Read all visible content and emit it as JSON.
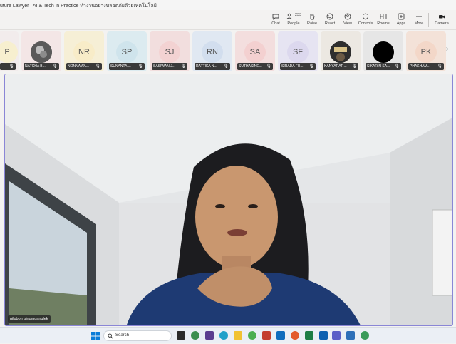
{
  "window": {
    "title": "uture Lawyer : AI & Tech in Practice ทำงานอย่างปลอดภัยด้วยเทคโนโลยี"
  },
  "toolbar": {
    "chat": "Chat",
    "people": "People",
    "people_count": "233",
    "raise": "Raise",
    "react": "React",
    "view": "View",
    "controls": "Controls",
    "rooms": "Rooms",
    "apps": "Apps",
    "more": "More",
    "camera": "Camera"
  },
  "participants": [
    {
      "initials": "P",
      "name": "",
      "color": "#f7efcf"
    },
    {
      "initials": "",
      "name": "NATCHA B...",
      "color": "#f3e6e6"
    },
    {
      "initials": "NR",
      "name": "NONNAWA...",
      "color": "#f6efd6"
    },
    {
      "initials": "SP",
      "name": "SUNANTA ...",
      "color": "#dcebf0"
    },
    {
      "initials": "SJ",
      "name": "SASIWAN J...",
      "color": "#f2dede"
    },
    {
      "initials": "RN",
      "name": "RATTIKA N...",
      "color": "#e0e8f2"
    },
    {
      "initials": "SA",
      "name": "SUTHASINE...",
      "color": "#f3dede"
    },
    {
      "initials": "SF",
      "name": "SIRADA FU...",
      "color": "#e6e4f2"
    },
    {
      "initials": "",
      "name": "KANYARAT ...",
      "color": "#ece8e2"
    },
    {
      "initials": "",
      "name": "SIKARIN SA...",
      "color": "#e6e6e6"
    },
    {
      "initials": "PK",
      "name": "PHAKHAM...",
      "color": "#f3e2d8"
    }
  ],
  "stage": {
    "speaker_name": "nilubon pingmuanglek"
  },
  "taskbar": {
    "search_placeholder": "Search"
  },
  "colors": {
    "accent": "#8a86d6",
    "badge": "#c4314b"
  }
}
